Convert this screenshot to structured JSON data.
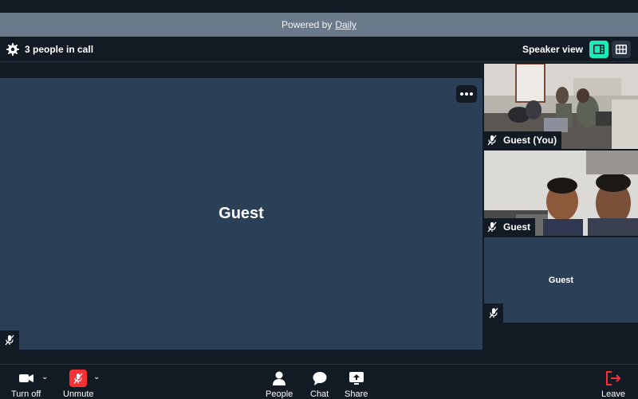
{
  "banner": {
    "prefix": "Powered by",
    "link": "Daily"
  },
  "header": {
    "people_count": "3 people in call",
    "view_label": "Speaker view"
  },
  "main_tile": {
    "name": "Guest"
  },
  "side_tiles": [
    {
      "name": "Guest (You)",
      "has_video": true
    },
    {
      "name": "Guest",
      "has_video": true
    },
    {
      "name": "Guest",
      "has_video": false
    }
  ],
  "tray": {
    "camera_label": "Turn off",
    "mic_label": "Unmute",
    "people_label": "People",
    "chat_label": "Chat",
    "share_label": "Share",
    "leave_label": "Leave"
  },
  "colors": {
    "accent": "#1bebb9",
    "background": "#121a24",
    "tile": "#2b3f56",
    "mic_muted": "#f63135",
    "leave": "#f63135"
  }
}
